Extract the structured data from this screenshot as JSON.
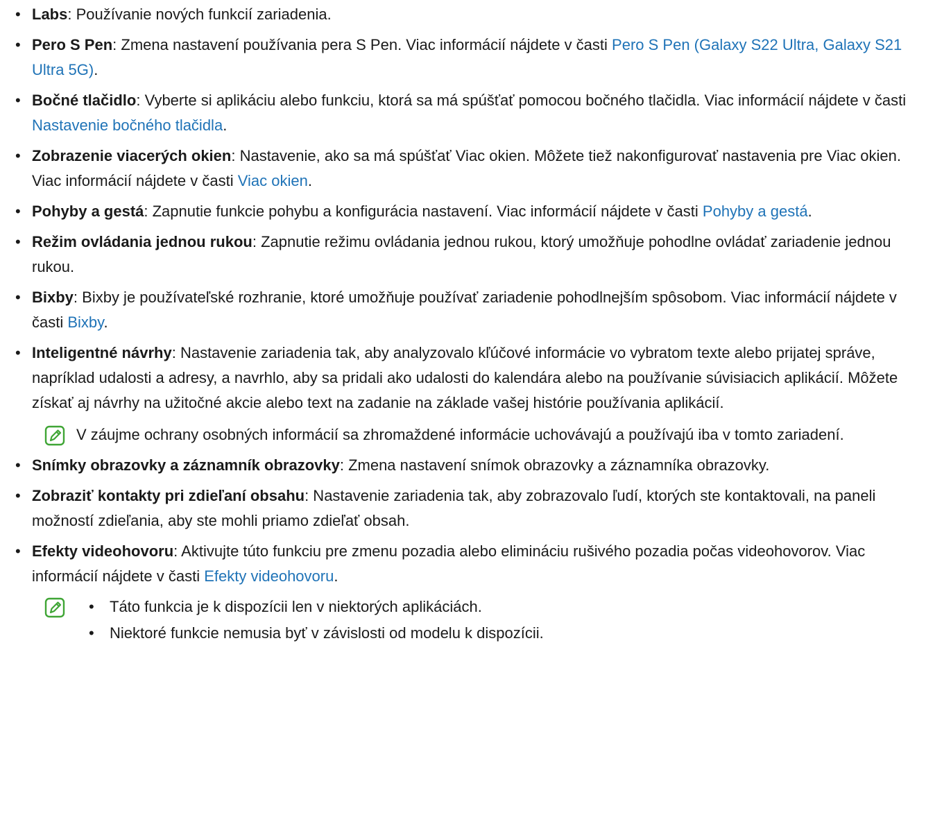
{
  "items": [
    {
      "term": "Labs",
      "text": ": Používanie nových funkcií zariadenia.",
      "link": "",
      "tail": ""
    },
    {
      "term": "Pero S Pen",
      "text": ": Zmena nastavení používania pera S Pen. Viac informácií nájdete v časti ",
      "link": "Pero S Pen (Galaxy S22 Ultra, Galaxy S21 Ultra 5G)",
      "tail": "."
    },
    {
      "term": "Bočné tlačidlo",
      "text": ": Vyberte si aplikáciu alebo funkciu, ktorá sa má spúšťať pomocou bočného tlačidla. Viac informácií nájdete v časti ",
      "link": "Nastavenie bočného tlačidla",
      "tail": "."
    },
    {
      "term": "Zobrazenie viacerých okien",
      "text": ": Nastavenie, ako sa má spúšťať Viac okien. Môžete tiež nakonfigurovať nastavenia pre Viac okien. Viac informácií nájdete v časti ",
      "link": "Viac okien",
      "tail": "."
    },
    {
      "term": "Pohyby a gestá",
      "text": ": Zapnutie funkcie pohybu a konfigurácia nastavení. Viac informácií nájdete v časti ",
      "link": "Pohyby a gestá",
      "tail": "."
    },
    {
      "term": "Režim ovládania jednou rukou",
      "text": ": Zapnutie režimu ovládania jednou rukou, ktorý umožňuje pohodlne ovládať zariadenie jednou rukou.",
      "link": "",
      "tail": ""
    },
    {
      "term": "Bixby",
      "text": ": Bixby je používateľské rozhranie, ktoré umožňuje používať zariadenie pohodlnejším spôsobom. Viac informácií nájdete v časti ",
      "link": "Bixby",
      "tail": "."
    },
    {
      "term": "Inteligentné návrhy",
      "text": ": Nastavenie zariadenia tak, aby analyzovalo kľúčové informácie vo vybratom texte alebo prijatej správe, napríklad udalosti a adresy, a navrhlo, aby sa pridali ako udalosti do kalendára alebo na používanie súvisiacich aplikácií. Môžete získať aj návrhy na užitočné akcie alebo text na zadanie na základe vašej histórie používania aplikácií.",
      "link": "",
      "tail": ""
    }
  ],
  "note1": "V záujme ochrany osobných informácií sa zhromaždené informácie uchovávajú a používajú iba v tomto zariadení.",
  "items2": [
    {
      "term": "Snímky obrazovky a záznamník obrazovky",
      "text": ": Zmena nastavení snímok obrazovky a záznamníka obrazovky.",
      "link": "",
      "tail": ""
    },
    {
      "term": "Zobraziť kontakty pri zdieľaní obsahu",
      "text": ": Nastavenie zariadenia tak, aby zobrazovalo ľudí, ktorých ste kontaktovali, na paneli možností zdieľania, aby ste mohli priamo zdieľať obsah.",
      "link": "",
      "tail": ""
    },
    {
      "term": "Efekty videohovoru",
      "text": ": Aktivujte túto funkciu pre zmenu pozadia alebo elimináciu rušivého pozadia počas videohovorov. Viac informácií nájdete v časti ",
      "link": "Efekty videohovoru",
      "tail": "."
    }
  ],
  "note2": [
    "Táto funkcia je k dispozícii len v niektorých aplikáciách.",
    "Niektoré funkcie nemusia byť v závislosti od modelu k dispozícii."
  ],
  "icons": {
    "note": "note-pencil-icon",
    "accent": "#3fa535",
    "link": "#1f73b7"
  }
}
